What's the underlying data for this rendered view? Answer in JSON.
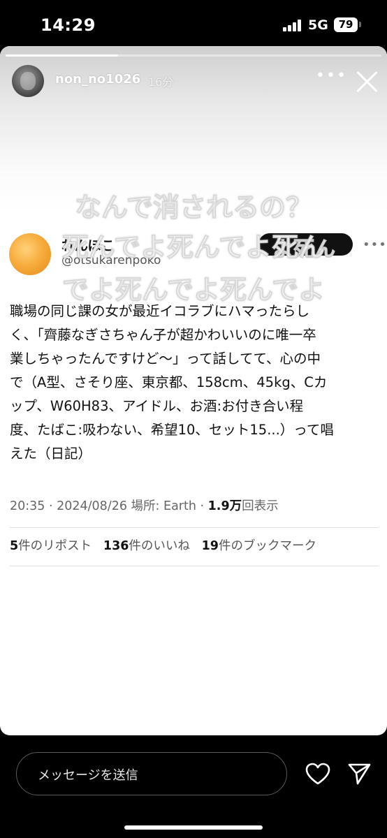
{
  "status_bar": {
    "time": "14:29",
    "network": "5G",
    "battery": "79"
  },
  "story": {
    "progress": 0.3,
    "username": "non_no1026",
    "time_ago": "16分",
    "overlay_lines": [
      "なんで消されるの？",
      "死んでよ死んでよ死ん",
      "でよ死んでよ死んでよ"
    ]
  },
  "tweet": {
    "display_name": "れんぽこ",
    "handle": "@otsukarenpoko",
    "follow_label": "よ死ん",
    "more": "•••",
    "body_lines": [
      "職場の同じ課の女が最近イコラブにハマったらし",
      "く、「齊藤なぎさちゃん子が超かわいいのに唯一卒",
      "業しちゃったんですけど〜」って話してて、心の中",
      "で（A型、さそり座、東京都、158cm、45kg、Cカ",
      "ップ、W60H83、アイドル、お酒:お付き合い程",
      "度、たばこ:吸わない、希望10、セット15...）って唱",
      "えた（日記）"
    ],
    "meta_prefix": "20:35 · 2024/08/26 場所: Earth · ",
    "views_count": "1.9万",
    "views_label": "回表示",
    "stats": {
      "reposts_count": "5",
      "reposts_label": "件のリポスト",
      "likes_count": "136",
      "likes_label": "件のいいね",
      "bookmarks_count": "19",
      "bookmarks_label": "件のブックマーク"
    }
  },
  "reply_bar": {
    "placeholder": "メッセージを送信"
  },
  "icons": [
    "more-icon",
    "close-icon",
    "heart-icon",
    "send-icon"
  ]
}
